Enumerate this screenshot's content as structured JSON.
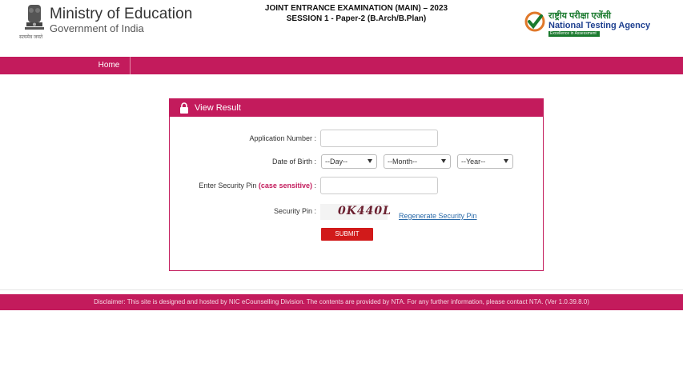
{
  "header": {
    "ministry_title": "Ministry of Education",
    "ministry_subtitle": "Government of India",
    "emblem_caption": "सत्यमेव जयते",
    "exam_line1": "JOINT ENTRANCE EXAMINATION (MAIN) – 2023",
    "exam_line2": "SESSION 1 - Paper-2 (B.Arch/B.Plan)",
    "nta_hindi": "राष्ट्रीय परीक्षा एजेंसी",
    "nta_english": "National Testing Agency",
    "nta_tagline": "Excellence in Assessment"
  },
  "nav": {
    "home_label": "Home"
  },
  "panel": {
    "title": "View Result",
    "application_label": "Application Number :",
    "application_value": "",
    "dob_label": "Date of Birth :",
    "day_option": "--Day--",
    "month_option": "--Month--",
    "year_option": "--Year--",
    "security_label_prefix": "Enter Security Pin",
    "security_label_cs": "(case sensitive)",
    "security_label_suffix": ":",
    "security_value": "",
    "security_pin_label": "Security Pin :",
    "captcha_text": "0K440L",
    "regenerate_label": "Regenerate Security Pin",
    "submit_label": "SUBMIT"
  },
  "footer": {
    "text": "Disclaimer: This site is designed and hosted by NIC eCounselling Division. The contents are provided by NTA. For any further information, please contact NTA. (Ver 1.0.39.8.0)"
  },
  "colors": {
    "brand": "#c31b5c",
    "submit": "#d11a1a",
    "link": "#2a6aa9"
  },
  "icons": {
    "emblem": "national-emblem-icon",
    "nta_logo": "nta-check-icon",
    "lock": "lock-icon"
  }
}
